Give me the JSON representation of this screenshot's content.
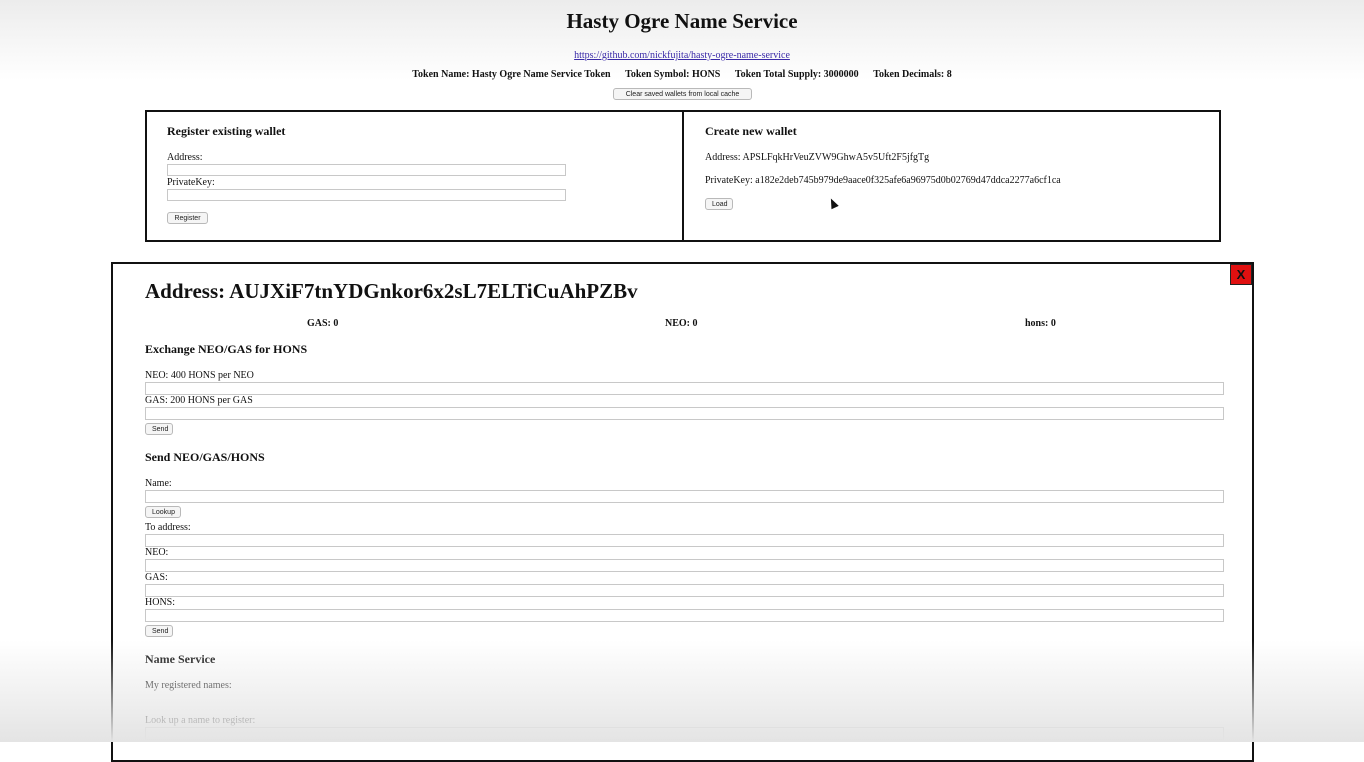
{
  "header": {
    "title": "Hasty Ogre Name Service",
    "repo_link": "https://github.com/nickfujita/hasty-ogre-name-service",
    "token_name": "Token Name: Hasty Ogre Name Service Token",
    "token_symbol": "Token Symbol: HONS",
    "token_supply": "Token Total Supply: 3000000",
    "token_decimals": "Token Decimals: 8",
    "clear_button": "Clear saved wallets from local cache"
  },
  "register_wallet": {
    "heading": "Register existing wallet",
    "address_label": "Address:",
    "address_value": "",
    "privatekey_label": "PrivateKey:",
    "privatekey_value": "",
    "register_button": "Register"
  },
  "create_wallet": {
    "heading": "Create new wallet",
    "address_text": "Address: APSLFqkHrVeuZVW9GhwA5v5Uft2F5jfgTg",
    "privatekey_text": "PrivateKey: a182e2deb745b979de9aace0f325afe6a96975d0b02769d47ddca2277a6cf1ca",
    "load_button": "Load"
  },
  "wallet_detail": {
    "close_label": "X",
    "close_color": "#e01010",
    "address_heading": "Address: AUJXiF7tnYDGnkor6x2sL7ELTiCuAhPZBv",
    "balances": {
      "gas": "GAS: 0",
      "neo": "NEO: 0",
      "hons": "hons: 0"
    },
    "exchange": {
      "heading": "Exchange NEO/GAS for HONS",
      "neo_label": "NEO: 400 HONS per NEO",
      "gas_label": "GAS: 200 HONS per GAS",
      "send_button": "Send"
    },
    "send": {
      "heading": "Send NEO/GAS/HONS",
      "name_label": "Name:",
      "lookup_button": "Lookup",
      "to_address_label": "To address:",
      "neo_label": "NEO:",
      "gas_label": "GAS:",
      "hons_label": "HONS:",
      "send_button": "Send"
    },
    "name_service": {
      "heading": "Name Service",
      "my_names_label": "My registered names:",
      "lookup_label": "Look up a name to register:"
    }
  }
}
